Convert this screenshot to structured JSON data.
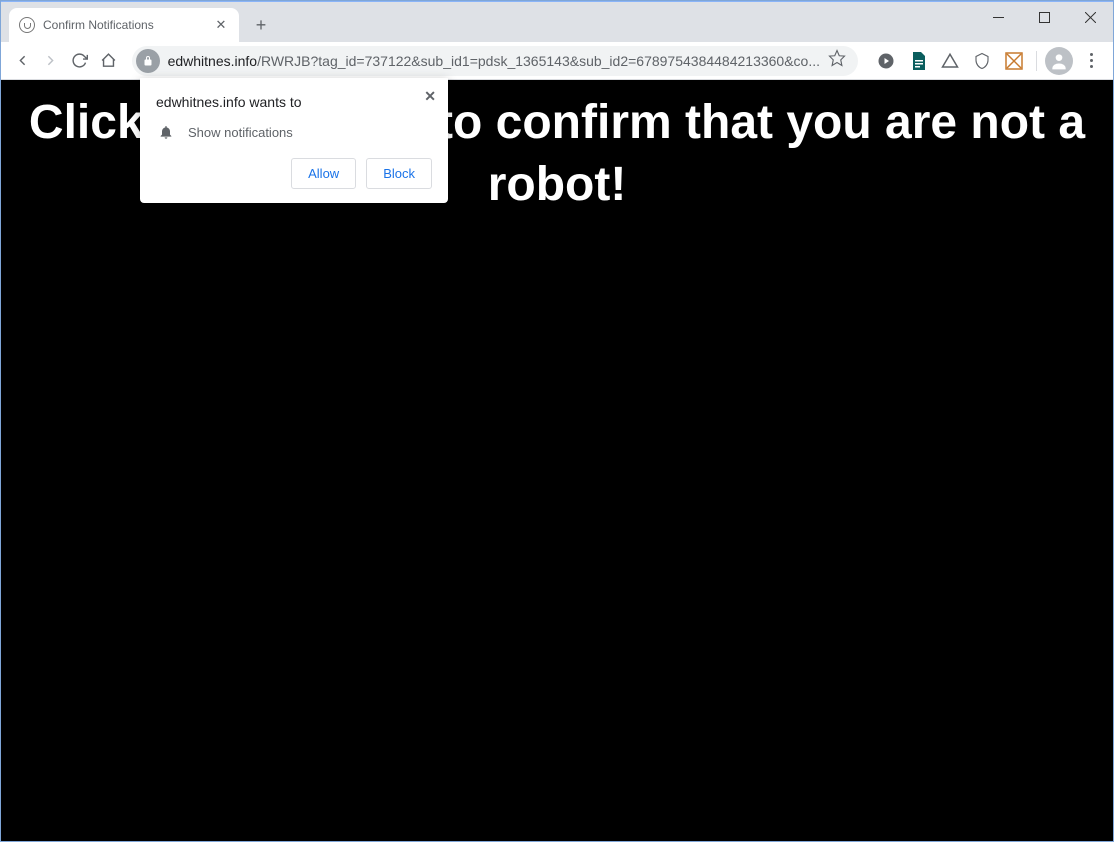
{
  "tab": {
    "title": "Confirm Notifications"
  },
  "url": {
    "host": "edwhitnes.info",
    "path": "/RWRJB?tag_id=737122&sub_id1=pdsk_1365143&sub_id2=6789754384484213360&co..."
  },
  "page": {
    "line1": "Click the «Allow» to confirm that you are not a",
    "line2": "robot!"
  },
  "popup": {
    "title": "edwhitnes.info wants to",
    "permission": "Show notifications",
    "allow": "Allow",
    "block": "Block"
  }
}
